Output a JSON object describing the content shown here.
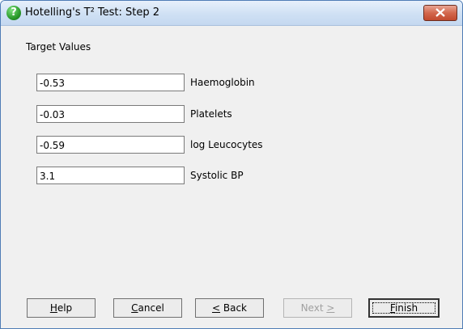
{
  "window": {
    "title": "Hotelling's T² Test: Step 2",
    "icon": "help-question-icon"
  },
  "group_label": "Target Values",
  "rows": [
    {
      "value": "-0.53",
      "label": "Haemoglobin"
    },
    {
      "value": "-0.03",
      "label": "Platelets"
    },
    {
      "value": "-0.59",
      "label": "log Leucocytes"
    },
    {
      "value": "3.1",
      "label": "Systolic BP"
    }
  ],
  "buttons": {
    "help": {
      "pre": "",
      "mnemonic": "H",
      "post": "elp"
    },
    "cancel": {
      "pre": "",
      "mnemonic": "C",
      "post": "ancel"
    },
    "back": {
      "pre": "",
      "mnemonic": "<",
      "post": " Back"
    },
    "next": {
      "pre": "Next ",
      "mnemonic": ">",
      "post": ""
    },
    "finish": {
      "pre": "",
      "mnemonic": "F",
      "post": "inish"
    }
  },
  "colors": {
    "close_button": "#c24a2e",
    "title_gradient": "#cfe0f4"
  }
}
